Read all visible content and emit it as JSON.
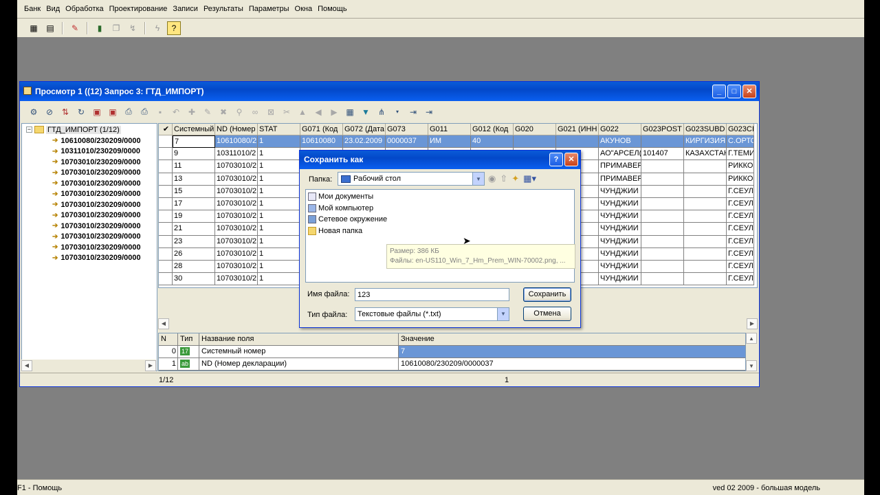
{
  "menu": [
    "Банк",
    "Вид",
    "Обработка",
    "Проектирование",
    "Записи",
    "Результаты",
    "Параметры",
    "Окна",
    "Помощь"
  ],
  "statusbar": {
    "left": "F1 - Помощь",
    "right": "ved 02 2009 - большая модель"
  },
  "child": {
    "title": "Просмотр 1 ((12) Запрос 3: ГТД_ИМПОРТ)",
    "tree": {
      "root": "ГТД_ИМПОРТ (1/12)",
      "items": [
        "10610080/230209/0000",
        "10311010/230209/0000",
        "10703010/230209/0000",
        "10703010/230209/0000",
        "10703010/230209/0000",
        "10703010/230209/0000",
        "10703010/230209/0000",
        "10703010/230209/0000",
        "10703010/230209/0000",
        "10703010/230209/0000",
        "10703010/230209/0000",
        "10703010/230209/0000"
      ]
    },
    "grid": {
      "columns": [
        {
          "header": "Системный",
          "cells": [
            "7",
            "9",
            "11",
            "13",
            "15",
            "17",
            "19",
            "21",
            "23",
            "26",
            "28",
            "30"
          ]
        },
        {
          "header": "ND (Номер",
          "cells": [
            "10610080/2",
            "10311010/2",
            "10703010/2",
            "10703010/2",
            "10703010/2",
            "10703010/2",
            "10703010/2",
            "10703010/2",
            "10703010/2",
            "10703010/2",
            "10703010/2",
            "10703010/2"
          ]
        },
        {
          "header": "STAT",
          "cells": [
            "1",
            "1",
            "1",
            "1",
            "1",
            "1",
            "1",
            "1",
            "1",
            "1",
            "1",
            "1"
          ]
        },
        {
          "header": "G071 (Код",
          "cells": [
            "10610080",
            "",
            "",
            "",
            "",
            "",
            "",
            "",
            "",
            "",
            "",
            ""
          ]
        },
        {
          "header": "G072 (Дата",
          "cells": [
            "23.02.2009",
            "",
            "",
            "",
            "",
            "",
            "",
            "",
            "",
            "",
            "",
            ""
          ]
        },
        {
          "header": "G073",
          "cells": [
            "0000037",
            "",
            "",
            "",
            "",
            "",
            "",
            "",
            "",
            "",
            "",
            ""
          ]
        },
        {
          "header": "G011",
          "cells": [
            "ИМ",
            "",
            "",
            "",
            "",
            "",
            "",
            "",
            "",
            "",
            "",
            ""
          ]
        },
        {
          "header": "G012 (Код",
          "cells": [
            "40",
            "",
            "",
            "",
            "",
            "",
            "",
            "",
            "",
            "",
            "",
            ""
          ]
        },
        {
          "header": "G020",
          "cells": [
            "",
            "",
            "",
            "",
            "",
            "",
            "",
            "",
            "",
            "",
            "",
            ""
          ]
        },
        {
          "header": "G021 (ИНН",
          "cells": [
            "",
            "",
            "",
            "",
            "",
            "",
            "",
            "",
            "",
            "",
            "",
            ""
          ]
        },
        {
          "header": "G022",
          "cells": [
            "АКУНОВ",
            "АО\"АРСЕЛ(",
            "ПРИМАВЕР",
            "ПРИМАВЕР",
            "ЧУНДЖИИ",
            "ЧУНДЖИИ",
            "ЧУНДЖИИ",
            "ЧУНДЖИИ",
            "ЧУНДЖИИ",
            "ЧУНДЖИИ",
            "ЧУНДЖИИ",
            "ЧУНДЖИИ"
          ]
        },
        {
          "header": "G023POST",
          "cells": [
            "",
            "101407",
            "",
            "",
            "",
            "",
            "",
            "",
            "",
            "",
            "",
            ""
          ]
        },
        {
          "header": "G023SUBD",
          "cells": [
            "КИРГИЗИЯ",
            "КАЗАХСТАН",
            "",
            "",
            "",
            "",
            "",
            "",
            "",
            "",
            "",
            ""
          ]
        },
        {
          "header": "G023CIT",
          "cells": [
            "С.ОРТО",
            "Г.ТЕМИ",
            "РИККОН",
            "РИККОН",
            "Г.СЕУЛ",
            "Г.СЕУЛ",
            "Г.СЕУЛ",
            "Г.СЕУЛ",
            "Г.СЕУЛ",
            "Г.СЕУЛ",
            "Г.СЕУЛ",
            "Г.СЕУЛ"
          ]
        }
      ]
    },
    "detail": {
      "headers": [
        "N",
        "Тип",
        "Название поля",
        "Значение"
      ],
      "rows": [
        {
          "n": "0",
          "type": "17",
          "name": "Системный номер",
          "value": "7"
        },
        {
          "n": "1",
          "type": "ab",
          "name": "ND (Номер декларации)",
          "value": "10610080/230209/0000037"
        }
      ]
    },
    "status": {
      "left": "1/12",
      "mid": "1"
    }
  },
  "dialog": {
    "title": "Сохранить как",
    "folder_label": "Папка:",
    "folder_value": "Рабочий стол",
    "files": [
      "Мои документы",
      "Мой компьютер",
      "Сетевое окружение",
      "Новая папка"
    ],
    "tooltip": {
      "size": "Размер: 386 КБ",
      "files": "Файлы: en-US110_Win_7_Hm_Prem_WIN-70002.png, ..."
    },
    "filename_label": "Имя файла:",
    "filename_value": "123",
    "filetype_label": "Тип файла:",
    "filetype_value": "Текстовые файлы (*.txt)",
    "save_label": "Сохранить",
    "cancel_label": "Отмена"
  }
}
